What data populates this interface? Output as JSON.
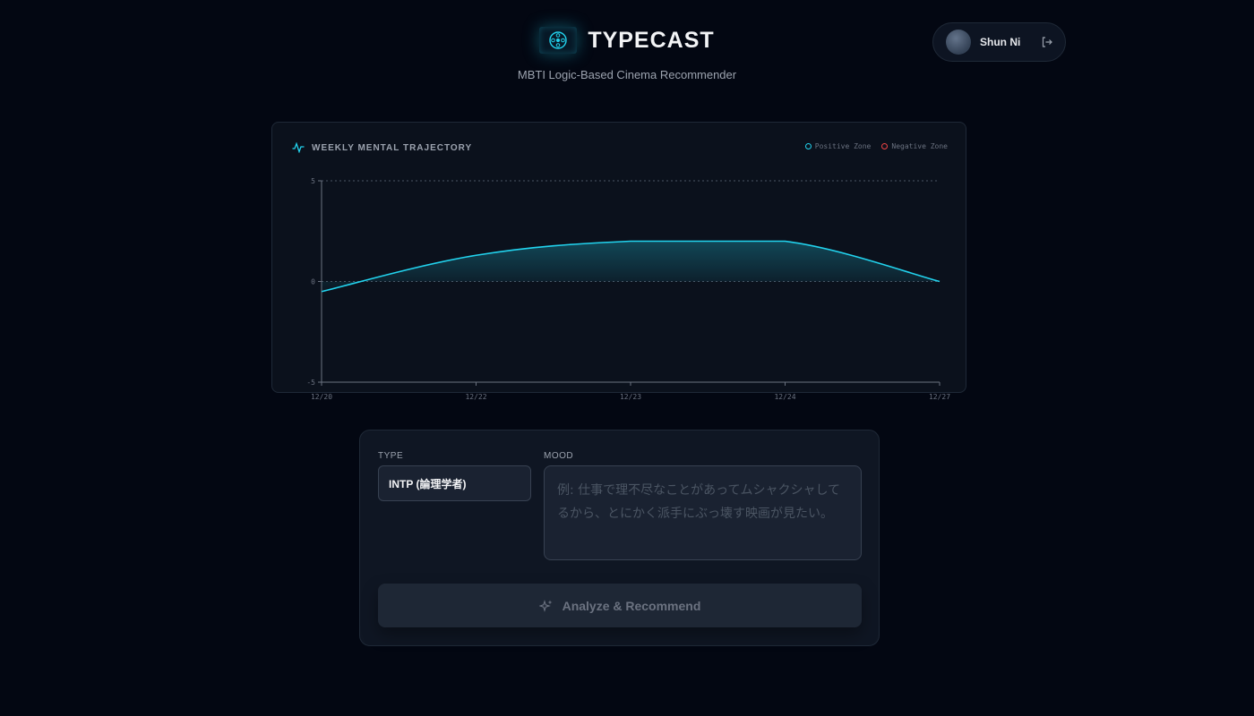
{
  "app": {
    "title": "TYPECAST",
    "subtitle": "MBTI Logic-Based Cinema Recommender"
  },
  "user": {
    "name": "Shun Ni",
    "logout_icon": "logout-icon"
  },
  "chart": {
    "title": "WEEKLY MENTAL TRAJECTORY",
    "legend": {
      "positive": "Positive Zone",
      "negative": "Negative Zone"
    }
  },
  "colors": {
    "accent": "#22d3ee",
    "negative": "#ef4444",
    "background": "#030712",
    "card": "#0b111c"
  },
  "chart_data": {
    "type": "area",
    "title": "WEEKLY MENTAL TRAJECTORY",
    "x": [
      "12/20",
      "12/22",
      "12/23",
      "12/24",
      "12/27"
    ],
    "series": [
      {
        "name": "Positive Zone",
        "values": [
          -0.5,
          1.3,
          2.0,
          2.0,
          0
        ]
      }
    ],
    "ylim": [
      -5,
      5
    ],
    "yticks": [
      5,
      0,
      -5
    ],
    "legend_position": "top-right",
    "grid": "dashed lines at 5 and 0"
  },
  "form": {
    "type_label": "TYPE",
    "type_value": "INTP (論理学者)",
    "mood_label": "MOOD",
    "mood_placeholder": "例: 仕事で理不尽なことがあってムシャクシャしてるから、とにかく派手にぶっ壊す映画が見たい。",
    "submit_label": "Analyze & Recommend",
    "submit_icon": "sparkles-icon"
  }
}
